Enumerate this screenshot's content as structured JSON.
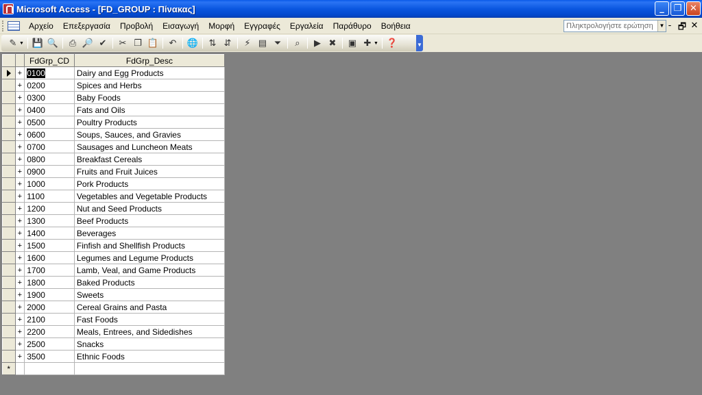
{
  "window": {
    "title": "Microsoft Access - [FD_GROUP : Πίνακας]",
    "buttons": [
      "_",
      "❐",
      "✕"
    ]
  },
  "menu": {
    "items": [
      "Αρχείο",
      "Επεξεργασία",
      "Προβολή",
      "Εισαγωγή",
      "Μορφή",
      "Εγγραφές",
      "Εργαλεία",
      "Παράθυρο",
      "Βοήθεια"
    ],
    "help_placeholder": "Πληκτρολογήστε ερώτηση",
    "mdi_buttons": [
      "-",
      "🗗",
      "✕"
    ]
  },
  "toolbar": {
    "icons": [
      "design-view-icon",
      "save-icon",
      "search-icon",
      "print-icon",
      "print-preview-icon",
      "spelling-icon",
      "cut-icon",
      "copy-icon",
      "paste-icon",
      "undo-icon",
      "hyperlink-icon",
      "sort-ascending-icon",
      "sort-descending-icon",
      "filter-by-selection-icon",
      "filter-by-form-icon",
      "apply-filter-icon",
      "find-icon",
      "new-record-icon",
      "delete-record-icon",
      "database-window-icon",
      "new-object-icon",
      "help-icon"
    ]
  },
  "table": {
    "columns": [
      "FdGrp_CD",
      "FdGrp_Desc"
    ],
    "rows": [
      [
        "0100",
        "Dairy and Egg Products"
      ],
      [
        "0200",
        "Spices and Herbs"
      ],
      [
        "0300",
        "Baby Foods"
      ],
      [
        "0400",
        "Fats and Oils"
      ],
      [
        "0500",
        "Poultry Products"
      ],
      [
        "0600",
        "Soups, Sauces, and Gravies"
      ],
      [
        "0700",
        "Sausages and Luncheon Meats"
      ],
      [
        "0800",
        "Breakfast Cereals"
      ],
      [
        "0900",
        "Fruits and Fruit Juices"
      ],
      [
        "1000",
        "Pork Products"
      ],
      [
        "1100",
        "Vegetables and Vegetable Products"
      ],
      [
        "1200",
        "Nut and Seed Products"
      ],
      [
        "1300",
        "Beef Products"
      ],
      [
        "1400",
        "Beverages"
      ],
      [
        "1500",
        "Finfish and Shellfish Products"
      ],
      [
        "1600",
        "Legumes and Legume Products"
      ],
      [
        "1700",
        "Lamb, Veal, and Game Products"
      ],
      [
        "1800",
        "Baked Products"
      ],
      [
        "1900",
        "Sweets"
      ],
      [
        "2000",
        "Cereal Grains and Pasta"
      ],
      [
        "2100",
        "Fast Foods"
      ],
      [
        "2200",
        "Meals, Entrees, and Sidedishes"
      ],
      [
        "2500",
        "Snacks"
      ],
      [
        "3500",
        "Ethnic Foods"
      ]
    ],
    "expand_glyph": "+",
    "new_row_glyph": "*"
  }
}
